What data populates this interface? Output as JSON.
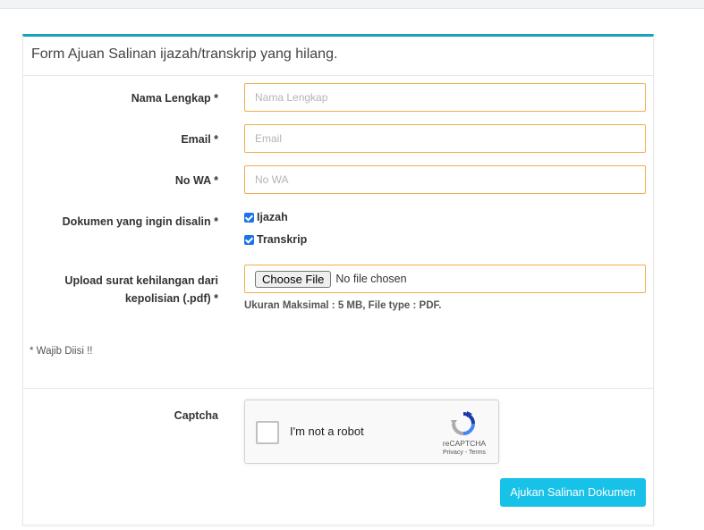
{
  "form": {
    "title": "Form Ajuan Salinan ijazah/transkrip yang hilang.",
    "nama": {
      "label": "Nama Lengkap *",
      "placeholder": "Nama Lengkap"
    },
    "email": {
      "label": "Email *",
      "placeholder": "Email"
    },
    "wa": {
      "label": "No WA *",
      "placeholder": "No WA"
    },
    "dokumen": {
      "label": "Dokumen yang ingin disalin *",
      "options": [
        {
          "label": "Ijazah",
          "checked": true
        },
        {
          "label": "Transkrip",
          "checked": true
        }
      ]
    },
    "upload": {
      "label_line1": "Upload surat kehilangan dari",
      "label_line2": "kepolisian (.pdf) *",
      "button": "Choose File",
      "status": "No file chosen",
      "hint": "Ukuran Maksimal : 5 MB, File type : PDF."
    },
    "required_note": "* Wajib Diisi !!",
    "captcha": {
      "label": "Captcha",
      "text": "I'm not a robot",
      "brand": "reCAPTCHA",
      "terms": "Privacy - Terms"
    },
    "submit_label": "Ajukan Salinan Dokumen"
  },
  "colors": {
    "accent": "#17a2b8",
    "input_border": "#f0ad4e",
    "button": "#17c1e8",
    "checkbox": "#1a73e8"
  }
}
